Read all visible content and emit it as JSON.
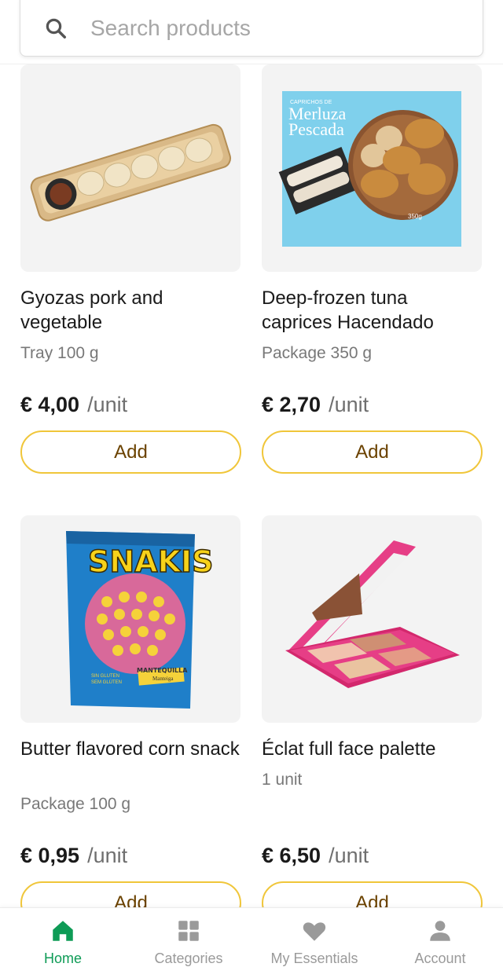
{
  "search": {
    "placeholder": "Search products"
  },
  "products": [
    {
      "name": "Gyozas pork and vegetable",
      "unit": "Tray 100 g",
      "price": "€ 4,00",
      "per": "/unit",
      "add_label": "Add",
      "image": "gyoza-tray-image"
    },
    {
      "name": "Deep-frozen tuna caprices Hacendado",
      "unit": "Package 350 g",
      "price": "€ 2,70",
      "per": "/unit",
      "add_label": "Add",
      "image": "croquettes-package-image",
      "package_text": {
        "small": "CAPRICHOS DE",
        "title1": "Merluza",
        "title2": "Pescada",
        "weight": "350g"
      }
    },
    {
      "name": "Butter flavored corn snack",
      "unit": "Package 100 g",
      "price": "€ 0,95",
      "per": "/unit",
      "add_label": "Add",
      "image": "snakis-bag-image",
      "package_text": {
        "brand": "SNAKIS",
        "flavor": "MANTEQUILLA",
        "flavor2": "Manteiga",
        "gluten1": "SIN GLUTEN",
        "gluten2": "SEM GLÚTEN"
      }
    },
    {
      "name": "Éclat full face palette",
      "unit": "1 unit",
      "price": "€ 6,50",
      "per": "/unit",
      "add_label": "Add",
      "image": "makeup-palette-image"
    }
  ],
  "nav": {
    "items": [
      {
        "label": "Home",
        "icon": "home-icon",
        "active": true
      },
      {
        "label": "Categories",
        "icon": "grid-icon",
        "active": false
      },
      {
        "label": "My Essentials",
        "icon": "heart-icon",
        "active": false
      },
      {
        "label": "Account",
        "icon": "person-icon",
        "active": false
      }
    ]
  },
  "colors": {
    "accent": "#0e9b56",
    "button_border": "#f0c63a",
    "button_text": "#6b4200",
    "muted": "#9a9a9a"
  }
}
